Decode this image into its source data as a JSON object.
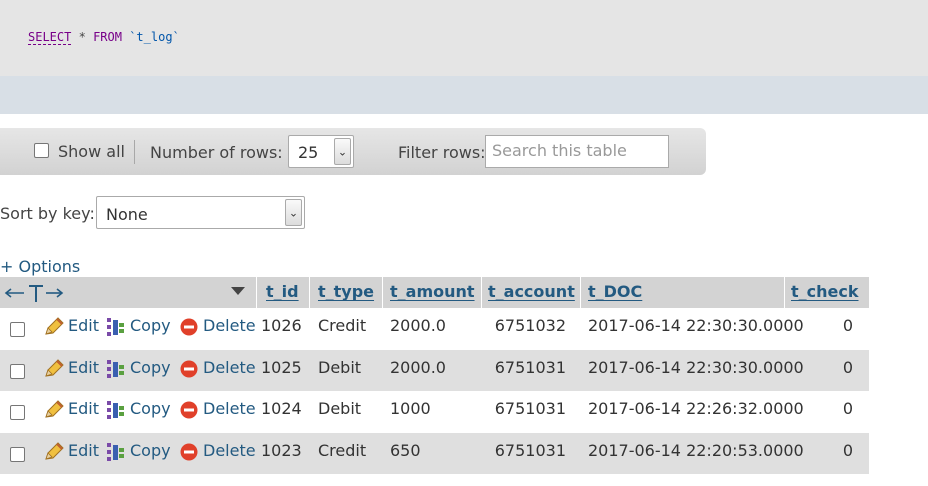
{
  "sql": {
    "select": "SELECT",
    "star": "*",
    "from": "FROM",
    "table": "`t_log`"
  },
  "nav": {
    "show_all": "Show all",
    "number_of_rows_label": "Number of rows:",
    "number_of_rows_value": "25",
    "filter_label": "Filter rows:",
    "filter_placeholder": "Search this table"
  },
  "sort": {
    "label": "Sort by key:",
    "value": "None"
  },
  "options_link": "+ Options",
  "columns": [
    "t_id",
    "t_type",
    "t_amount",
    "t_account",
    "t_DOC",
    "t_check"
  ],
  "actions": {
    "edit": "Edit",
    "copy": "Copy",
    "delete": "Delete"
  },
  "rows": [
    {
      "t_id": "1026",
      "t_type": "Credit",
      "t_amount": "2000.0",
      "t_account": "6751032",
      "t_DOC": "2017-06-14 22:30:30.0000",
      "t_check": "0"
    },
    {
      "t_id": "1025",
      "t_type": "Debit",
      "t_amount": "2000.0",
      "t_account": "6751031",
      "t_DOC": "2017-06-14 22:30:30.0000",
      "t_check": "0"
    },
    {
      "t_id": "1024",
      "t_type": "Debit",
      "t_amount": "1000",
      "t_account": "6751031",
      "t_DOC": "2017-06-14 22:26:32.0000",
      "t_check": "0"
    },
    {
      "t_id": "1023",
      "t_type": "Credit",
      "t_amount": "650",
      "t_account": "6751031",
      "t_DOC": "2017-06-14 22:20:53.0000",
      "t_check": "0"
    }
  ],
  "colors": {
    "link": "#235a81",
    "sql_keyword": "#770088",
    "delete_icon": "#e0402a"
  }
}
